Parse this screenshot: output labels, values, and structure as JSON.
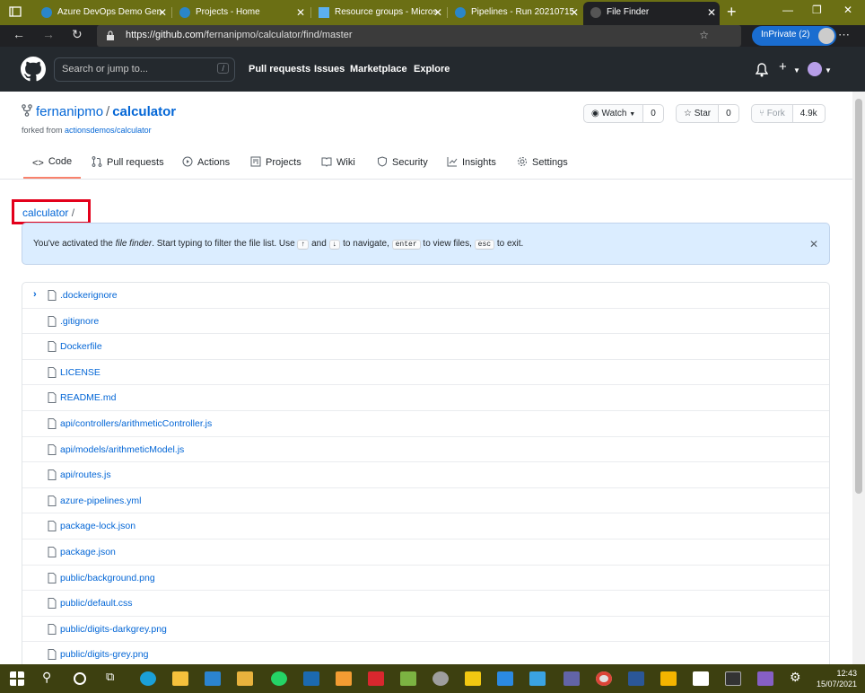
{
  "browser": {
    "tabs": [
      {
        "label": "Azure DevOps Demo Gen",
        "color": "#2a86c9"
      },
      {
        "label": "Projects - Home",
        "color": "#2a86c9"
      },
      {
        "label": "Resource groups - Micros",
        "color": "#5bb0f0"
      },
      {
        "label": "Pipelines - Run 20210715.",
        "color": "#2a86c9"
      },
      {
        "label": "File Finder",
        "color": "#555"
      }
    ],
    "url_host": "https://github.com",
    "url_path": "/fernanipmo/calculator/find/master",
    "inprivate": "InPrivate (2)"
  },
  "github": {
    "search_placeholder": "Search or jump to...",
    "search_key": "/",
    "nav": [
      "Pull requests",
      "Issues",
      "Marketplace",
      "Explore"
    ]
  },
  "repo": {
    "owner": "fernanipmo",
    "separator": "/",
    "name": "calculator",
    "forked_from_label": "forked from",
    "forked_from": "actionsdemos/calculator",
    "watch_label": "Watch",
    "watch_count": "0",
    "star_label": "Star",
    "star_count": "0",
    "fork_label": "Fork",
    "fork_count": "4.9k",
    "tabs": [
      "Code",
      "Pull requests",
      "Actions",
      "Projects",
      "Wiki",
      "Security",
      "Insights",
      "Settings"
    ]
  },
  "breadcrumb": {
    "root": "calculator",
    "sep": "/"
  },
  "flash": {
    "t1": "You've activated the ",
    "em": "file finder",
    "t2": ". Start typing to filter the file list. Use ",
    "k1": "↑",
    "t3": " and ",
    "k2": "↓",
    "t4": " to navigate, ",
    "k3": "enter",
    "t5": " to view files, ",
    "k4": "esc",
    "t6": " to exit."
  },
  "files": [
    ".dockerignore",
    ".gitignore",
    "Dockerfile",
    "LICENSE",
    "README.md",
    "api/controllers/arithmeticController.js",
    "api/models/arithmeticModel.js",
    "api/routes.js",
    "azure-pipelines.yml",
    "package-lock.json",
    "package.json",
    "public/background.png",
    "public/default.css",
    "public/digits-darkgrey.png",
    "public/digits-grey.png"
  ],
  "taskbar": {
    "time": "12:43",
    "date": "15/07/2021"
  },
  "colors": {
    "accent": "#0366d6",
    "highlight": "#e3001b",
    "tab_underline": "#f9826c"
  }
}
